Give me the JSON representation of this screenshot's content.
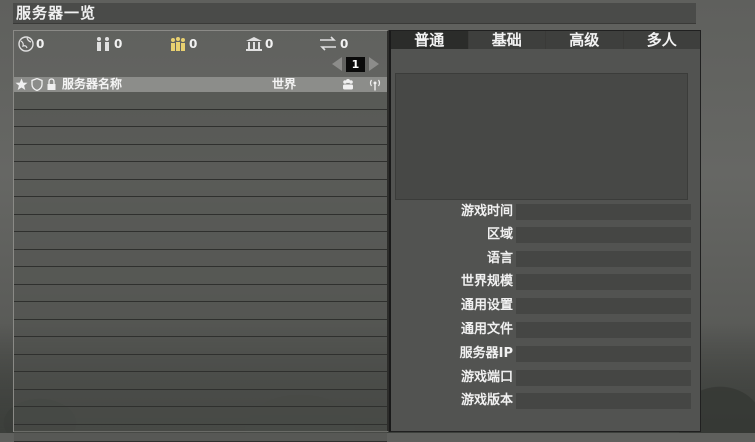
{
  "window": {
    "title": "服务器一览"
  },
  "stats": [
    {
      "icon": "globe-icon",
      "value": "0"
    },
    {
      "icon": "players-icon",
      "value": "0"
    },
    {
      "icon": "friends-icon",
      "value": "0"
    },
    {
      "icon": "official-server-icon",
      "value": "0"
    },
    {
      "icon": "swap-icon",
      "value": "0"
    }
  ],
  "pager": {
    "current_page": "1"
  },
  "list_header": {
    "icons": [
      "star-icon",
      "shield-icon",
      "lock-icon"
    ],
    "name_label": "服务器名称",
    "world_label": "世界",
    "extra_icons": [
      "players-icon",
      "ping-icon"
    ]
  },
  "server_rows_visible": 20,
  "tabs": [
    {
      "label": "普通",
      "active": true
    },
    {
      "label": "基础",
      "active": false
    },
    {
      "label": "高级",
      "active": false
    },
    {
      "label": "多人",
      "active": false
    }
  ],
  "details": [
    {
      "label": "游戏时间",
      "value": ""
    },
    {
      "label": "区域",
      "value": ""
    },
    {
      "label": "语言",
      "value": ""
    },
    {
      "label": "世界规模",
      "value": ""
    },
    {
      "label": "通用设置",
      "value": ""
    },
    {
      "label": "通用文件",
      "value": ""
    },
    {
      "label": "服务器IP",
      "value": ""
    },
    {
      "label": "游戏端口",
      "value": ""
    },
    {
      "label": "游戏版本",
      "value": ""
    }
  ]
}
